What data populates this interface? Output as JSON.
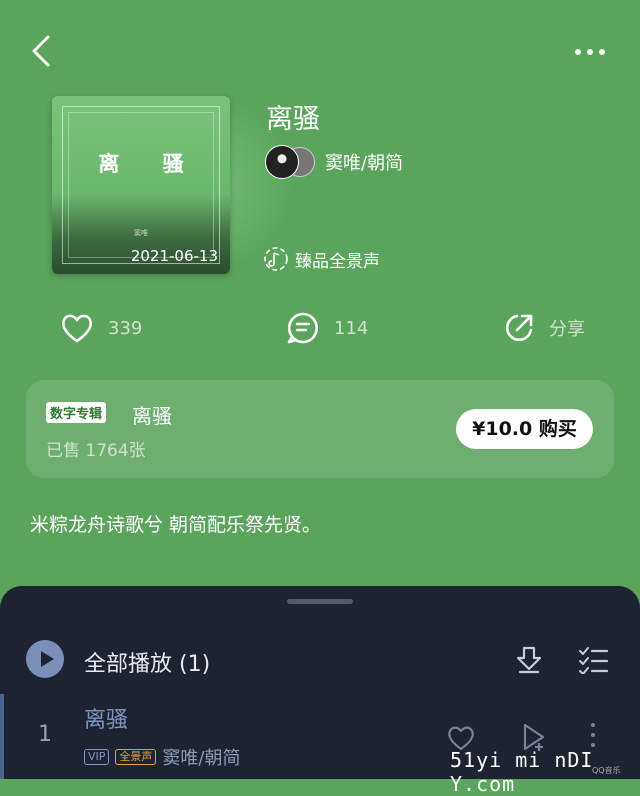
{
  "header": {
    "back_icon": "chevron-left-icon",
    "more_icon": "more-dots-icon"
  },
  "album": {
    "cover_title": "离 骚",
    "cover_small_text": "窦唯",
    "date": "2021-06-13",
    "title": "离骚",
    "artists": "窦唯/朝简",
    "quality_label": "臻品全景声"
  },
  "actions": {
    "likes": "339",
    "comments": "114",
    "share_label": "分享"
  },
  "purchase": {
    "tag": "数字专辑",
    "title": "离骚",
    "sold": "已售 1764张",
    "buy_label": "¥10.0 购买"
  },
  "description": "米粽龙舟诗歌兮 朝简配乐祭先贤。",
  "tracklist": {
    "play_all_label": "全部播放 (1)",
    "tracks": [
      {
        "index": "1",
        "title": "离骚",
        "vip": "VIP",
        "quality": "全景声",
        "artist": "窦唯/朝简"
      }
    ]
  },
  "watermark": {
    "main": "51yi mi nDI Y.com",
    "small": "QQ音乐"
  }
}
